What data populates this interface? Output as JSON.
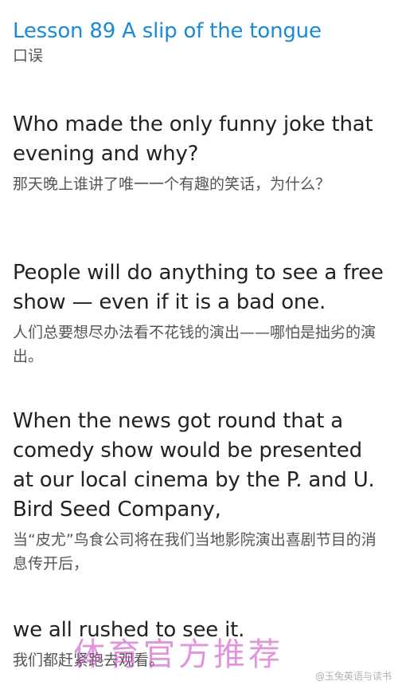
{
  "header": {
    "title": "Lesson 89 A slip of the tongue",
    "subtitle": "口误"
  },
  "sections": [
    {
      "en": "Who made the only funny joke that evening and why?",
      "zh": "那天晚上谁讲了唯一一个有趣的笑话，为什么？"
    },
    {
      "en": "People will do anything to see a free show — even if it is a bad one.",
      "zh": "人们总要想尽办法看不花钱的演出——哪怕是拙劣的演出。"
    },
    {
      "en": "When the news got round that a comedy show would be presented at our local cinema by the P. and U. Bird Seed Company,",
      "zh": "当“皮尤”鸟食公司将在我们当地影院演出喜剧节目的消息传开后，"
    },
    {
      "en": "we all rushed to see it.",
      "zh": "我们都赶紧跑去观看。"
    }
  ],
  "watermarks": {
    "overlay": "体育官方推荐",
    "source": "@玉兔英语与读书"
  }
}
